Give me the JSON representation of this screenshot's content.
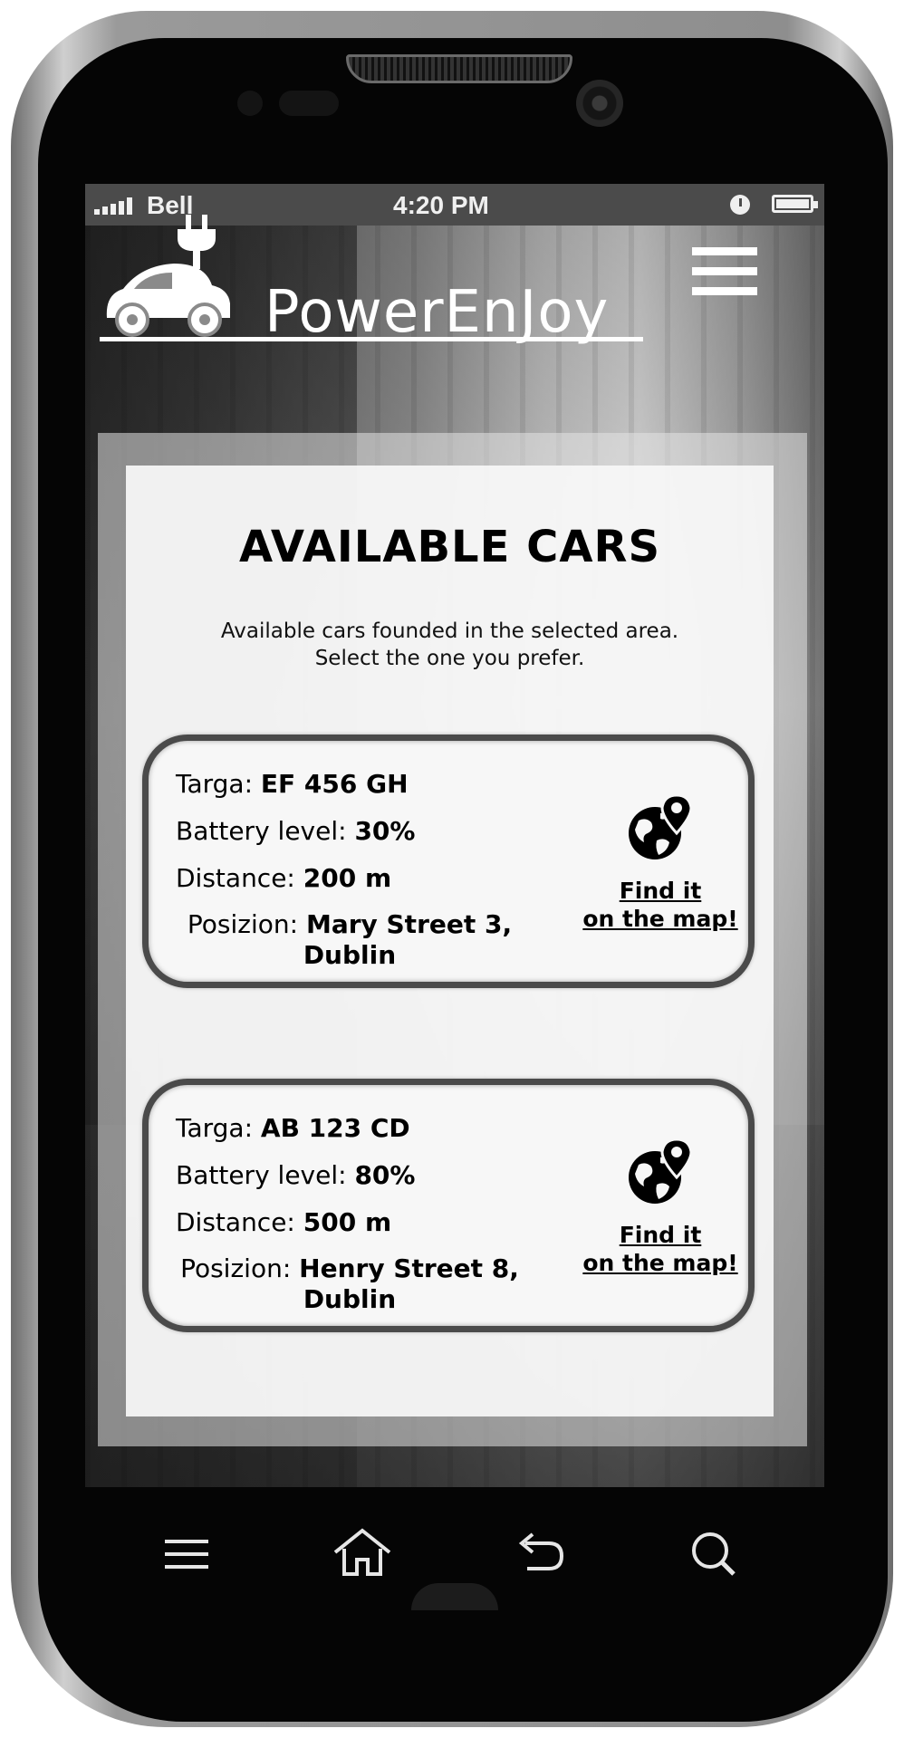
{
  "status_bar": {
    "carrier": "Bell",
    "time": "4:20 PM"
  },
  "header": {
    "logo_text": "PowerEnJoy"
  },
  "page": {
    "title": "AVAILABLE CARS",
    "subtitle_line1": "Available cars founded in the selected area.",
    "subtitle_line2": "Select the one you prefer."
  },
  "labels": {
    "plate": "Targa: ",
    "battery": "Battery level: ",
    "distance": "Distance: ",
    "position": "Posizion: ",
    "map_line1": "Find it ",
    "map_line2": "on the map!"
  },
  "cars": [
    {
      "plate": "EF 456 GH",
      "battery": "30%",
      "distance": "200 m",
      "street": "Mary Street 3,",
      "city": "Dublin"
    },
    {
      "plate": "AB 123 CD",
      "battery": "80%",
      "distance": "500 m",
      "street": "Henry Street 8,",
      "city": "Dublin"
    }
  ],
  "icons": {
    "menu": "hamburger-menu-icon",
    "map": "globe-location-icon",
    "nav_menu": "menu-lines-icon",
    "nav_home": "home-icon",
    "nav_back": "back-arrow-icon",
    "nav_search": "search-icon"
  },
  "colors": {
    "text": "#000000",
    "panel": "#f6f6f6",
    "status_bar": "#4b4b4b"
  }
}
